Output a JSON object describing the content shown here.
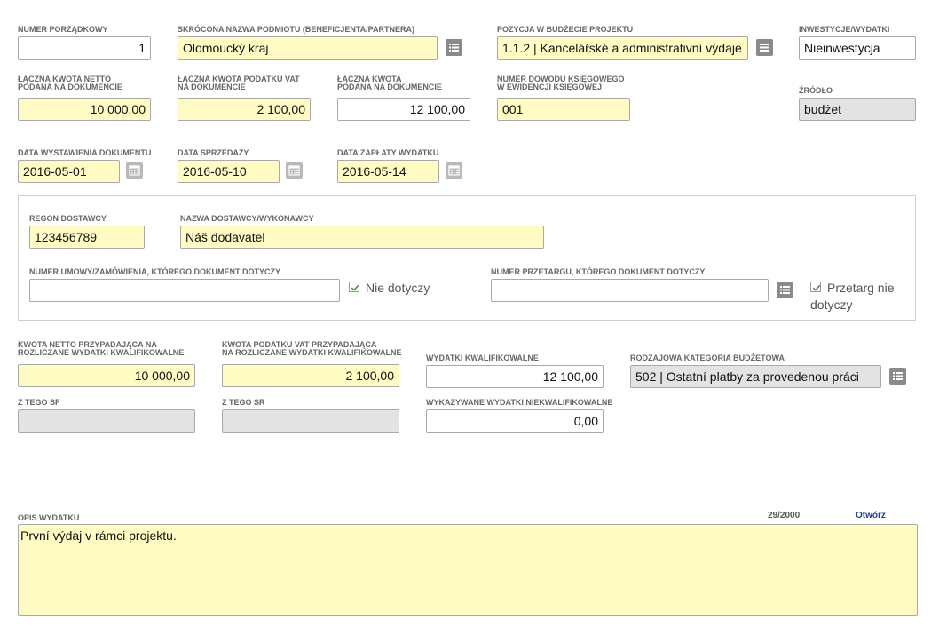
{
  "row1": {
    "numer_label": "NUMER PORZĄDKOWY",
    "numer_value": "1",
    "podmiot_label": "SKRÓCONA NAZWA PODMIOTU (BENEFICJENTA/PARTNERA)",
    "podmiot_value": "Olomoucký kraj",
    "pozycja_label": "POZYCJA W BUDŻECIE PROJEKTU",
    "pozycja_value": "1.1.2 | Kancelářské a administrativní výdaje",
    "inwest_label": "INWESTYCJE/WYDATKI",
    "inwest_value": "Nieinwestycja"
  },
  "row2": {
    "netto_label_1": "ŁĄCZNA KWOTA NETTO",
    "netto_label_2": "PODANA NA DOKUMENCIE",
    "netto_value": "10 000,00",
    "vat_label_1": "ŁĄCZNA KWOTA PODATKU VAT",
    "vat_label_2": "NA DOKUMENCIE",
    "vat_value": "2 100,00",
    "kwota_label_1": "ŁĄCZNA KWOTA",
    "kwota_label_2": "PODANA NA DOKUMENCIE",
    "kwota_value": "12 100,00",
    "dowod_label_1": "NUMER DOWODU KSIĘGOWEGO",
    "dowod_label_2": "W EWIDENCJI KSIĘGOWEJ",
    "dowod_value": "001",
    "zrodlo_label": "ŹRÓDŁO",
    "zrodlo_value": "budżet"
  },
  "row3": {
    "wyst_label": "DATA WYSTAWIENIA DOKUMENTU",
    "wyst_value": "2016-05-01",
    "sprz_label": "DATA SPRZEDAŻY",
    "sprz_value": "2016-05-10",
    "zapl_label": "DATA ZAPŁATY WYDATKU",
    "zapl_value": "2016-05-14"
  },
  "dostawca": {
    "regon_label": "REGON DOSTAWCY",
    "regon_value": "123456789",
    "nazwa_label": "NAZWA DOSTAWCY/WYKONAWCY",
    "nazwa_value": "Náš dodavatel",
    "umowa_label": "NUMER UMOWY/ZAMÓWIENIA, KTÓREGO DOKUMENT DOTYCZY",
    "umowa_value": "",
    "umowa_check": "Nie dotyczy",
    "przetarg_label": "NUMER PRZETARGU, KTÓREGO DOKUMENT DOTYCZY",
    "przetarg_value": "",
    "przetarg_check_1": "Przetarg nie",
    "przetarg_check_2": "dotyczy"
  },
  "row5": {
    "kn_label_1": "KWOTA NETTO PRZYPADAJĄCA NA",
    "kn_label_2": "ROZLICZANE WYDATKI KWALIFIKOWALNE",
    "kn_value": "10 000,00",
    "kv_label_1": "KWOTA PODATKU VAT PRZYPADAJĄCA",
    "kv_label_2": "NA ROZLICZANE WYDATKI KWALIFIKOWALNE",
    "kv_value": "2 100,00",
    "wk_label": "WYDATKI KWALIFIKOWALNE",
    "wk_value": "12 100,00",
    "rk_label": "RODZAJOWA KATEGORIA BUDŻETOWA",
    "rk_value": "502 | Ostatní platby za provedenou práci"
  },
  "row6": {
    "sf_label": "Z TEGO SF",
    "sf_value": "",
    "sr_label": "Z TEGO SR",
    "sr_value": "",
    "wn_label": "WYKAZYWANE WYDATKI NIEKWALIFIKOWALNE",
    "wn_value": "0,00"
  },
  "opis": {
    "label": "OPIS WYDATKU",
    "counter": "29/2000",
    "open_link": "Otwórz",
    "value": "První výdaj v rámci projektu."
  },
  "colors": {
    "required_bg": "#fffbc2",
    "readonly_bg": "#e3e3e3",
    "link": "#1c3f94"
  },
  "icons": {
    "list": "list-icon",
    "calendar": "calendar-icon",
    "checkmark": "checkmark-icon"
  }
}
